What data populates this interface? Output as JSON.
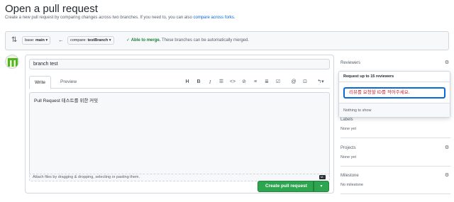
{
  "header": {
    "title": "Open a pull request",
    "subtitle_prefix": "Create a new pull request by comparing changes across two branches. If you need to, you can also ",
    "subtitle_link": "compare across forks",
    "subtitle_suffix": "."
  },
  "range": {
    "base_label": "base:",
    "base_value": "main",
    "compare_label": "compare:",
    "compare_value": "testBranch",
    "merge_ok": "Able to merge.",
    "merge_rest": "These branches can be automatically merged."
  },
  "form": {
    "title_value": "branch test",
    "tabs": [
      "Write",
      "Preview"
    ],
    "toolbar_icons": [
      "heading-icon",
      "bold-icon",
      "italic-icon",
      "quote-icon",
      "code-icon",
      "link-icon",
      "unordered-list-icon",
      "ordered-list-icon",
      "task-list-icon",
      "mention-icon",
      "reference-icon",
      "reply-icon"
    ],
    "body_value": "Pull Request 테스트를 위한 커밋",
    "attach_hint": "Attach files by dragging & dropping, selecting or pasting them.",
    "create_label": "Create pull request"
  },
  "sidebar": {
    "reviewers": "Reviewers",
    "popover_title": "Request up to 15 reviewers",
    "popover_input": "리뷰를 요청할 ID를 적어주세요.",
    "popover_empty": "Nothing to show",
    "labels": "Labels",
    "labels_value": "None yet",
    "projects": "Projects",
    "projects_value": "None yet",
    "milestone": "Milestone",
    "milestone_value": "No milestone"
  },
  "colors": {
    "accent": "#0969da",
    "success": "#2da44e",
    "danger": "#cf222e"
  }
}
